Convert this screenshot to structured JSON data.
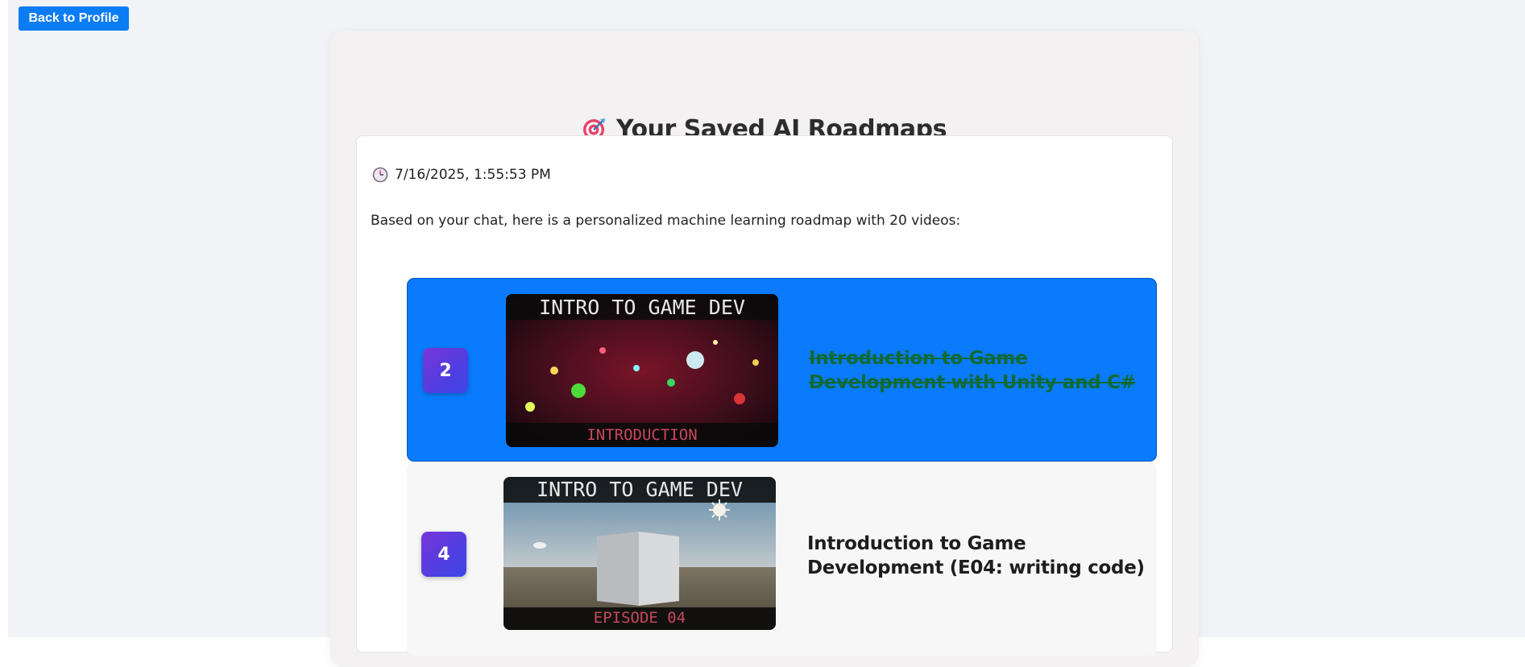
{
  "back_button": {
    "label": "Back to Profile"
  },
  "page": {
    "title": "Your Saved AI Roadmaps",
    "title_icon": "target-icon"
  },
  "roadmap": {
    "timestamp": "7/16/2025, 1:55:53 PM",
    "timestamp_icon": "clock-icon",
    "description": "Based on your chat, here is a personalized machine learning roadmap with 20 videos:",
    "videos": [
      {
        "number": "2",
        "title": "Introduction to Game Development with Unity and C#",
        "thumbnail_top_text": "INTRO TO GAME DEV",
        "thumbnail_bottom_text": "INTRODUCTION",
        "completed": true
      },
      {
        "number": "4",
        "title": "Introduction to Game Development (E04: writing code)",
        "thumbnail_top_text": "INTRO TO GAME DEV",
        "thumbnail_bottom_text": "EPISODE 04",
        "completed": false
      }
    ]
  },
  "colors": {
    "accent": "#0a7cf4",
    "completed_title": "#116a35",
    "badge_gradient": [
      "#7a35d9",
      "#3e46e8"
    ]
  }
}
